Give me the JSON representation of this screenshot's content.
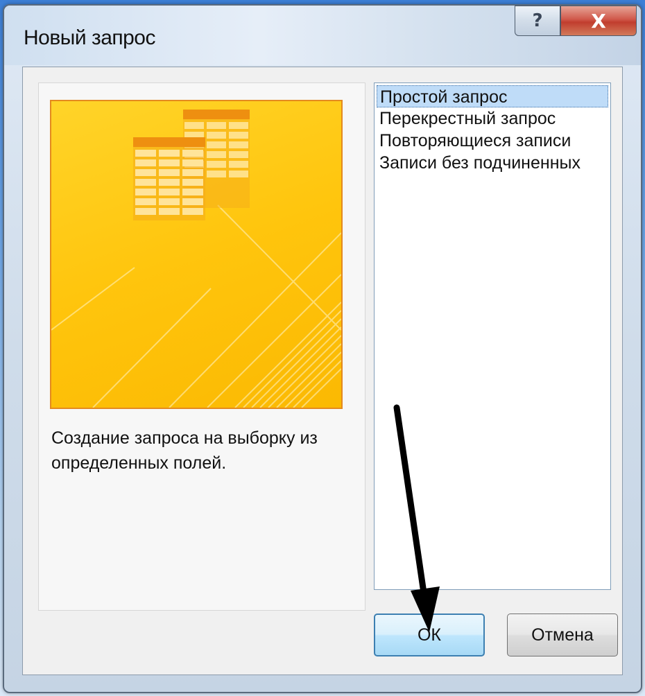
{
  "window": {
    "title": "Новый запрос",
    "help_label": "?",
    "close_label": "X"
  },
  "description": "Создание запроса на выборку из определенных полей.",
  "query_types": {
    "items": [
      {
        "label": "Простой запрос",
        "selected": true
      },
      {
        "label": "Перекрестный запрос",
        "selected": false
      },
      {
        "label": "Повторяющиеся записи",
        "selected": false
      },
      {
        "label": "Записи без подчиненных",
        "selected": false
      }
    ]
  },
  "buttons": {
    "ok_label": "ОК",
    "cancel_label": "Отмена"
  },
  "colors": {
    "illustration_fill": "#ffc50d",
    "illustration_border": "#e48a1e",
    "selection": "#bfdcf8",
    "close_button": "#c13d2e"
  },
  "icons": {
    "illustration": "table-grid-illustration",
    "help": "question-mark-icon",
    "close": "close-icon",
    "annotation": "pointer-arrow"
  }
}
